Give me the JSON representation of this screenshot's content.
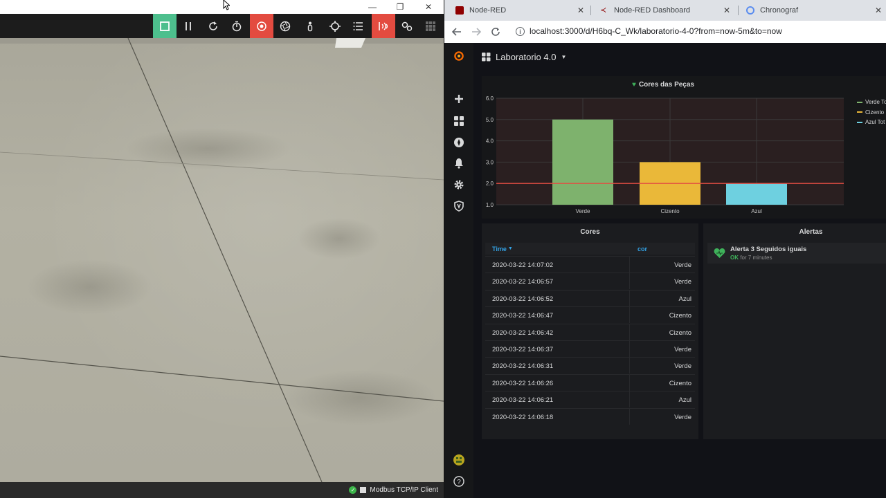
{
  "sim": {
    "window_controls": {
      "minimize": "—",
      "restore": "❐",
      "close": "✕"
    },
    "toolbar": [
      {
        "name": "stop-button",
        "icon": "stop-icon",
        "bg": "#4dbf8d"
      },
      {
        "name": "pause-button",
        "icon": "pause-icon",
        "bg": ""
      },
      {
        "name": "reset-button",
        "icon": "reset-icon",
        "bg": ""
      },
      {
        "name": "timer-button",
        "icon": "timer-icon",
        "bg": ""
      },
      {
        "name": "camera-button",
        "icon": "camera-icon",
        "bg": "#e34b40"
      },
      {
        "name": "view-button",
        "icon": "aperture-icon",
        "bg": ""
      },
      {
        "name": "person-button",
        "icon": "person-icon",
        "bg": ""
      },
      {
        "name": "target-button",
        "icon": "target-icon",
        "bg": ""
      },
      {
        "name": "list-button",
        "icon": "list-icon",
        "bg": ""
      },
      {
        "name": "sensors-button",
        "icon": "sensors-icon",
        "bg": "#e34b40"
      },
      {
        "name": "drivers-button",
        "icon": "drivers-icon",
        "bg": ""
      },
      {
        "name": "grid-button",
        "icon": "grid-icon",
        "bg": ""
      }
    ],
    "status": {
      "driver": "Modbus TCP/IP Client"
    }
  },
  "browser": {
    "tabs": [
      {
        "label": "Node-RED",
        "icon": "node-red-icon",
        "color": "#8f0000"
      },
      {
        "label": "Node-RED Dashboard",
        "icon": "node-red-dashboard-icon",
        "color": "#8f0000"
      },
      {
        "label": "Chronograf",
        "icon": "chronograf-icon",
        "color": "#5b8def"
      }
    ],
    "tab_close": "✕",
    "url": "localhost:3000/d/H6bq-C_Wk/laboratorio-4-0?from=now-5m&to=now"
  },
  "grafana": {
    "dashboard_title": "Laboratorio 4.0",
    "chart_panel_title": "Cores das Peças",
    "table_panel_title": "Cores",
    "alert_panel_title": "Alertas",
    "table": {
      "columns": [
        "Time",
        "cor"
      ],
      "rows": [
        {
          "time": "2020-03-22 14:07:02",
          "cor": "Verde"
        },
        {
          "time": "2020-03-22 14:06:57",
          "cor": "Verde"
        },
        {
          "time": "2020-03-22 14:06:52",
          "cor": "Azul"
        },
        {
          "time": "2020-03-22 14:06:47",
          "cor": "Cizento"
        },
        {
          "time": "2020-03-22 14:06:42",
          "cor": "Cizento"
        },
        {
          "time": "2020-03-22 14:06:37",
          "cor": "Verde"
        },
        {
          "time": "2020-03-22 14:06:31",
          "cor": "Verde"
        },
        {
          "time": "2020-03-22 14:06:26",
          "cor": "Cizento"
        },
        {
          "time": "2020-03-22 14:06:21",
          "cor": "Azul"
        },
        {
          "time": "2020-03-22 14:06:18",
          "cor": "Verde"
        }
      ]
    },
    "alert": {
      "name": "Alerta 3 Seguidos iguais",
      "state": "OK",
      "duration": "for 7 minutes"
    }
  },
  "chart_data": {
    "type": "bar",
    "title": "Cores das Peças",
    "categories": [
      "Verde",
      "Cizento",
      "Azul"
    ],
    "series": [
      {
        "name": "Verde Tot",
        "values": [
          5,
          null,
          null
        ],
        "color": "#7eb26d"
      },
      {
        "name": "Cizento",
        "values": [
          null,
          3,
          null
        ],
        "color": "#eab839"
      },
      {
        "name": "Azul Tot",
        "values": [
          null,
          null,
          2
        ],
        "color": "#6ed0e0"
      }
    ],
    "yticks": [
      "6.0",
      "5.0",
      "4.0",
      "3.0",
      "2.0",
      "1.0"
    ],
    "ylim": [
      1,
      6
    ],
    "threshold": 2,
    "threshold_color": "#e24d42",
    "grid": true,
    "legend_position": "right"
  }
}
